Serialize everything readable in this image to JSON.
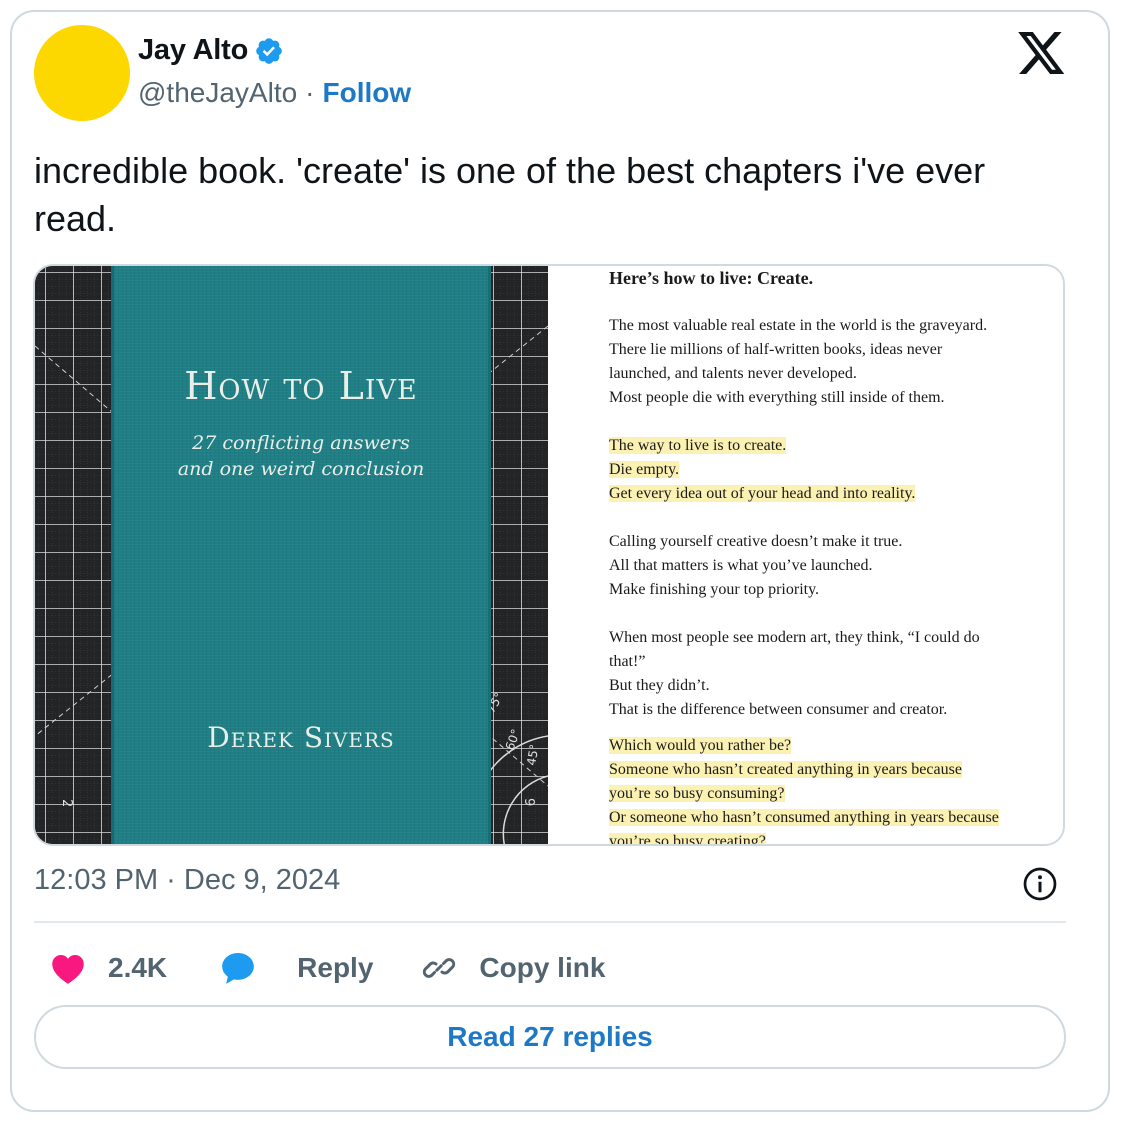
{
  "author": {
    "name": "Jay Alto",
    "handle": "@theJayAlto",
    "separator": "·",
    "follow_label": "Follow",
    "avatar_color": "#fcd800",
    "verified_icon": "verified-badge-icon"
  },
  "platform_icon": "x-logo-icon",
  "tweet": {
    "text": "incredible book. 'create' is one of the best chapters i've ever read."
  },
  "media": {
    "book": {
      "title": "How to Live",
      "subtitle_line1": "27 conflicting answers",
      "subtitle_line2": "and one weird conclusion",
      "author": "Derek Sivers",
      "cover_color": "#1f7f86"
    },
    "cutting_mat": {
      "labels": [
        "75°",
        "60°",
        "45°",
        "2",
        "9"
      ]
    },
    "excerpt": {
      "title": "Here’s how to live: Create.",
      "paragraphs": [
        {
          "highlighted": false,
          "lines": [
            "The most valuable real estate in the world is the graveyard.",
            "There lie millions of half-written books, ideas never",
            "launched, and talents never developed.",
            "Most people die with everything still inside of them."
          ]
        },
        {
          "highlighted": true,
          "lines": [
            "The way to live is to create.",
            "Die empty.",
            "Get every idea out of your head and into reality."
          ]
        },
        {
          "highlighted": false,
          "lines": [
            "Calling yourself creative doesn’t make it true.",
            "All that matters is what you’ve launched.",
            "Make finishing your top priority."
          ]
        },
        {
          "highlighted": false,
          "lines": [
            "When most people see modern art, they think, “I could do",
            "that!”",
            "But they didn’t.",
            "That is the difference between consumer and creator."
          ]
        },
        {
          "highlighted": true,
          "lines": [
            "Which would you rather be?",
            "Someone who hasn’t created anything in years because",
            "you’re so busy consuming?",
            "Or someone who hasn’t consumed anything in years because",
            "you’re so busy creating?"
          ]
        }
      ],
      "highlight_color": "#fbf1b3"
    }
  },
  "timestamp": "12:03 PM · Dec 9, 2024",
  "actions": {
    "like_count": "2.4K",
    "reply_label": "Reply",
    "copy_link_label": "Copy link",
    "like_color": "#f91880",
    "reply_color": "#1d9bf0"
  },
  "read_replies_label": "Read 27 replies",
  "colors": {
    "accent": "#1d79c6",
    "muted": "#536471",
    "border": "#cfd9de"
  }
}
